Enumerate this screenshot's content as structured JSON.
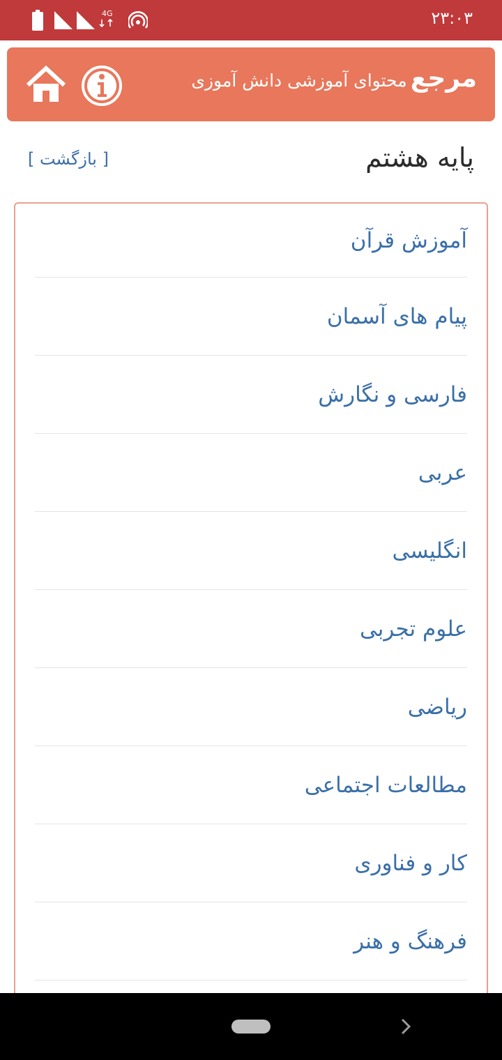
{
  "status": {
    "time": "۲۳:۰۳",
    "network": "4G"
  },
  "header": {
    "brand": "مرجع",
    "subtitle": "محتوای آموزشی دانش آموزی",
    "home_icon": "home-icon",
    "info_icon": "info-icon",
    "bg_color": "#e8775b"
  },
  "page": {
    "title": "پایه هشتم",
    "back_label": "[ بازگشت ]"
  },
  "subjects": [
    {
      "label": "آموزش قرآن"
    },
    {
      "label": "پیام های آسمان"
    },
    {
      "label": "فارسی و نگارش"
    },
    {
      "label": "عربی"
    },
    {
      "label": "انگلیسی"
    },
    {
      "label": "علوم تجربی"
    },
    {
      "label": "ریاضی"
    },
    {
      "label": "مطالعات اجتماعی"
    },
    {
      "label": "کار و فناوری"
    },
    {
      "label": "فرهنگ و هنر"
    }
  ],
  "colors": {
    "status_bar": "#c0393b",
    "link": "#3a6fa8",
    "card_border": "#e8a08e"
  }
}
